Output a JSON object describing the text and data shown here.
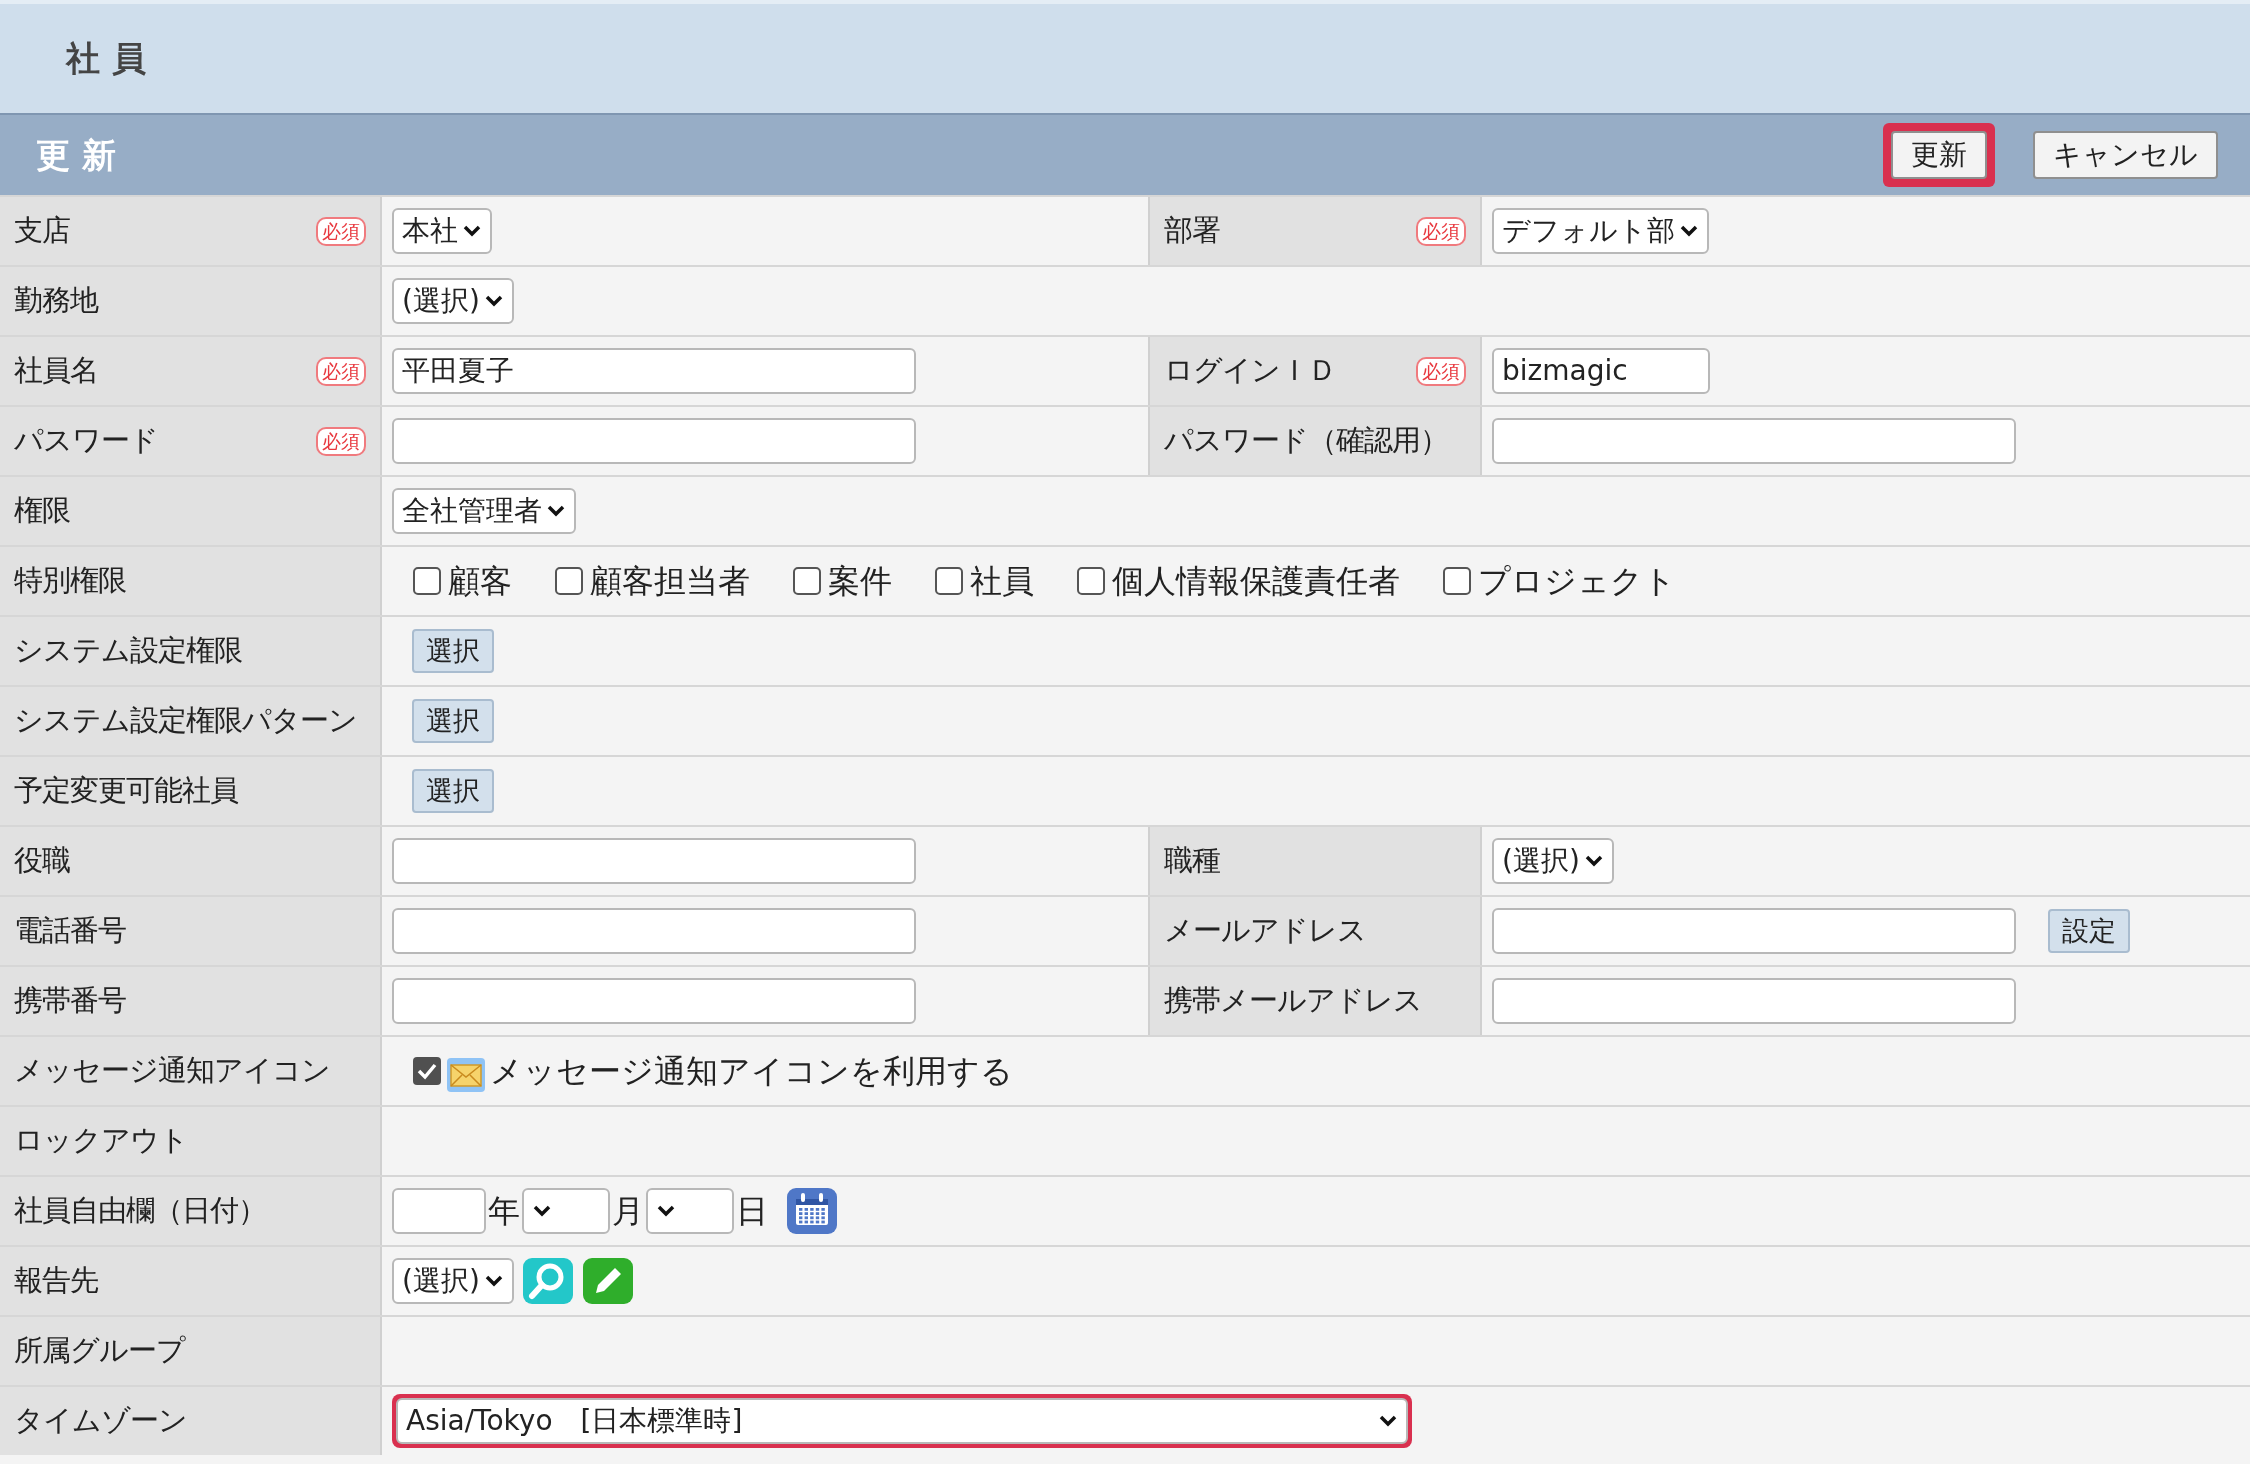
{
  "header": {
    "title": "社 員"
  },
  "action_bar": {
    "title": "更 新",
    "buttons": [
      {
        "label": "更新",
        "highlighted": true
      },
      {
        "label": "キャンセル",
        "highlighted": false
      }
    ]
  },
  "rows": [
    {
      "fields": [
        {
          "label": "支店",
          "badge": "必須",
          "control": {
            "kind": "select",
            "value": "本社"
          }
        },
        {
          "label": "部署",
          "badge": "必須",
          "control": {
            "kind": "select",
            "value": "デフォルト部"
          }
        }
      ]
    },
    {
      "fields": [
        {
          "label": "勤務地",
          "control": {
            "kind": "select",
            "value": "(選択)"
          }
        }
      ]
    },
    {
      "fields": [
        {
          "label": "社員名",
          "badge": "必須",
          "control": {
            "kind": "text",
            "value": "平田夏子"
          }
        },
        {
          "label": "ログインＩＤ",
          "badge": "必須",
          "control": {
            "kind": "short_text",
            "value": "bizmagic"
          }
        }
      ]
    },
    {
      "fields": [
        {
          "label": "パスワード",
          "badge": "必須",
          "control": {
            "kind": "text"
          }
        },
        {
          "label": "パスワード（確認用）",
          "control": {
            "kind": "text"
          }
        }
      ]
    },
    {
      "fields": [
        {
          "label": "権限",
          "control": {
            "kind": "select",
            "value": "全社管理者"
          }
        }
      ]
    },
    {
      "fields": [
        {
          "label": "特別権限",
          "control": {
            "kind": "checkboxes",
            "options": [
              {
                "label": "顧客",
                "checked": false
              },
              {
                "label": "顧客担当者",
                "checked": false
              },
              {
                "label": "案件",
                "checked": false
              },
              {
                "label": "社員",
                "checked": false
              },
              {
                "label": "個人情報保護責任者",
                "checked": false
              },
              {
                "label": "プロジェクト",
                "checked": false
              }
            ]
          }
        }
      ]
    },
    {
      "fields": [
        {
          "label": "システム設定権限",
          "control": {
            "kind": "button",
            "label": "選択"
          }
        }
      ]
    },
    {
      "fields": [
        {
          "label": "システム設定権限パターン",
          "control": {
            "kind": "button",
            "label": "選択"
          }
        }
      ]
    },
    {
      "fields": [
        {
          "label": "予定変更可能社員",
          "control": {
            "kind": "button",
            "label": "選択"
          }
        }
      ]
    },
    {
      "fields": [
        {
          "label": "役職",
          "control": {
            "kind": "text"
          }
        },
        {
          "label": "職種",
          "control": {
            "kind": "select",
            "value": "(選択)"
          }
        }
      ]
    },
    {
      "fields": [
        {
          "label": "電話番号",
          "control": {
            "kind": "text"
          }
        },
        {
          "label": "メールアドレス",
          "control": {
            "kind": "text_button",
            "label": "設定"
          }
        }
      ]
    },
    {
      "fields": [
        {
          "label": "携帯番号",
          "control": {
            "kind": "text"
          }
        },
        {
          "label": "携帯メールアドレス",
          "control": {
            "kind": "text"
          }
        }
      ]
    },
    {
      "fields": [
        {
          "label": "メッセージ通知アイコン",
          "control": {
            "kind": "check_icon",
            "checked": true,
            "label": "メッセージ通知アイコンを利用する"
          }
        }
      ]
    },
    {
      "fields": [
        {
          "label": "ロックアウト",
          "control": {
            "kind": "none"
          }
        }
      ]
    },
    {
      "fields": [
        {
          "label": "社員自由欄（日付）",
          "control": {
            "kind": "date",
            "year": "年",
            "month": "月",
            "day": "日"
          }
        }
      ]
    },
    {
      "fields": [
        {
          "label": "報告先",
          "control": {
            "kind": "select_icons",
            "value": "(選択)"
          }
        }
      ]
    },
    {
      "fields": [
        {
          "label": "所属グループ",
          "control": {
            "kind": "none"
          }
        }
      ]
    },
    {
      "fields": [
        {
          "label": "タイムゾーン",
          "control": {
            "kind": "wide_select",
            "value": "Asia/Tokyo　[日本標準時]",
            "highlighted": true
          }
        }
      ]
    }
  ]
}
